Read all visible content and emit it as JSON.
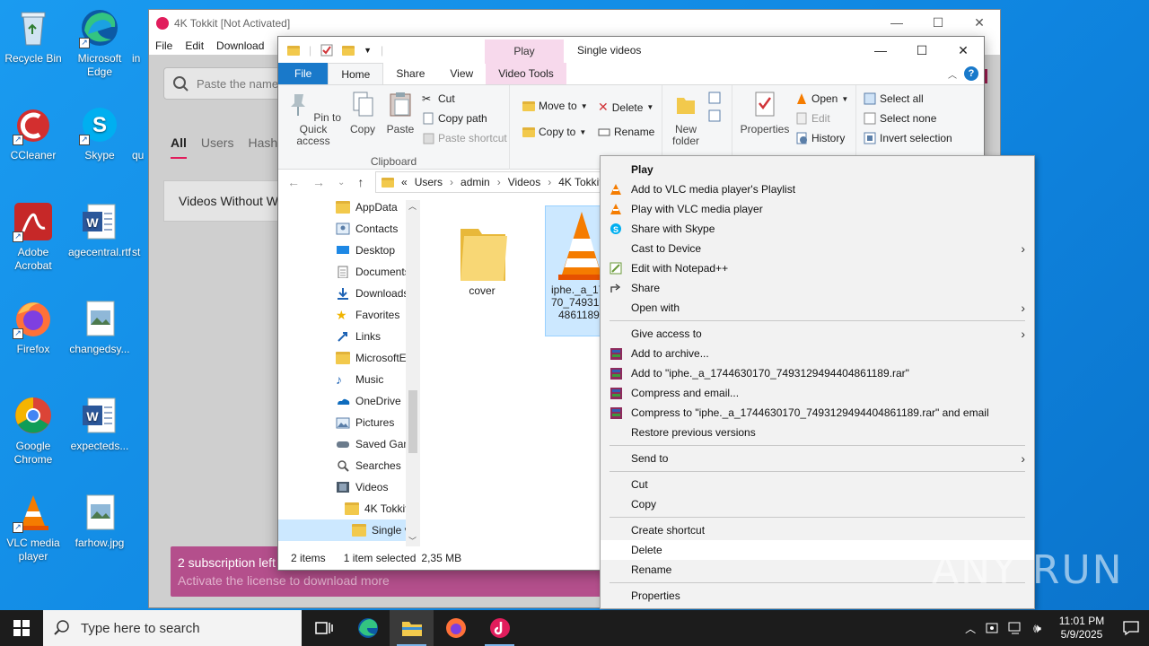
{
  "desktop": {
    "icons": [
      {
        "label": "Recycle Bin"
      },
      {
        "label": "Microsoft Edge"
      },
      {
        "label": "CCleaner"
      },
      {
        "label": "Skype"
      },
      {
        "label": "Adobe Acrobat"
      },
      {
        "label": "agecentral.rtf"
      },
      {
        "label": "Firefox"
      },
      {
        "label": "changedsy..."
      },
      {
        "label": "Google Chrome"
      },
      {
        "label": "expecteds..."
      },
      {
        "label": "VLC media player"
      },
      {
        "label": "farhow.jpg"
      }
    ],
    "partial_labels": [
      "in",
      "qu",
      "st"
    ]
  },
  "tokkit": {
    "title": "4K Tokkit [Not Activated]",
    "menu": [
      "File",
      "Edit",
      "Download"
    ],
    "search_placeholder": "Paste the name",
    "tabs": [
      "All",
      "Users",
      "Hash"
    ],
    "card_title": "Videos Without W",
    "subscription_line1": "2 subscription left",
    "subscription_line2": "Activate the license to download more"
  },
  "explorer": {
    "window_title": "Single videos",
    "context_tab_top": "Play",
    "ribbon_tabs": [
      "File",
      "Home",
      "Share",
      "View",
      "Video Tools"
    ],
    "clipboard": {
      "pin": "Pin to Quick access",
      "copy": "Copy",
      "paste": "Paste",
      "cut": "Cut",
      "copy_path": "Copy path",
      "paste_shortcut": "Paste shortcut",
      "label": "Clipboard"
    },
    "organize": {
      "move_to": "Move to",
      "copy_to": "Copy to",
      "delete": "Delete",
      "rename": "Rename",
      "label": "Organi"
    },
    "new": {
      "new_folder": "New folder"
    },
    "open": {
      "properties": "Properties",
      "open": "Open",
      "edit": "Edit",
      "history": "History"
    },
    "select": {
      "select_all": "Select all",
      "select_none": "Select none",
      "invert": "Invert selection"
    },
    "address": [
      "«",
      "Users",
      "admin",
      "Videos",
      "4K Tokkit"
    ],
    "nav_items": [
      "AppData",
      "Contacts",
      "Desktop",
      "Documents",
      "Downloads",
      "Favorites",
      "Links",
      "MicrosoftEdge",
      "Music",
      "OneDrive",
      "Pictures",
      "Saved Games",
      "Searches",
      "Videos",
      "4K Tokkit",
      "Single videos"
    ],
    "files": [
      {
        "name": "cover"
      },
      {
        "name": "iphe._a_1744630170_7493129494404861189"
      }
    ],
    "file_name_lines": [
      "iphe._a_17",
      "70_749312",
      "4861189"
    ],
    "status": {
      "items": "2 items",
      "selected": "1 item selected",
      "size": "2,35 MB"
    }
  },
  "context_menu": {
    "items": [
      {
        "label": "Play",
        "bold": true
      },
      {
        "label": "Add to VLC media player's Playlist"
      },
      {
        "label": "Play with VLC media player"
      },
      {
        "label": "Share with Skype"
      },
      {
        "label": "Cast to Device",
        "submenu": true
      },
      {
        "label": "Edit with Notepad++"
      },
      {
        "label": "Share"
      },
      {
        "label": "Open with",
        "submenu": true
      },
      {
        "label": "Give access to",
        "submenu": true
      },
      {
        "label": "Add to archive..."
      },
      {
        "label": "Add to \"iphe._a_1744630170_7493129494404861189.rar\""
      },
      {
        "label": "Compress and email..."
      },
      {
        "label": "Compress to \"iphe._a_1744630170_7493129494404861189.rar\" and email"
      },
      {
        "label": "Restore previous versions"
      },
      {
        "label": "Send to",
        "submenu": true
      },
      {
        "label": "Cut"
      },
      {
        "label": "Copy"
      },
      {
        "label": "Create shortcut"
      },
      {
        "label": "Delete"
      },
      {
        "label": "Rename"
      },
      {
        "label": "Properties"
      }
    ]
  },
  "taskbar": {
    "search_placeholder": "Type here to search",
    "time": "11:01 PM",
    "date": "5/9/2025"
  },
  "watermark": "ANY RUN"
}
